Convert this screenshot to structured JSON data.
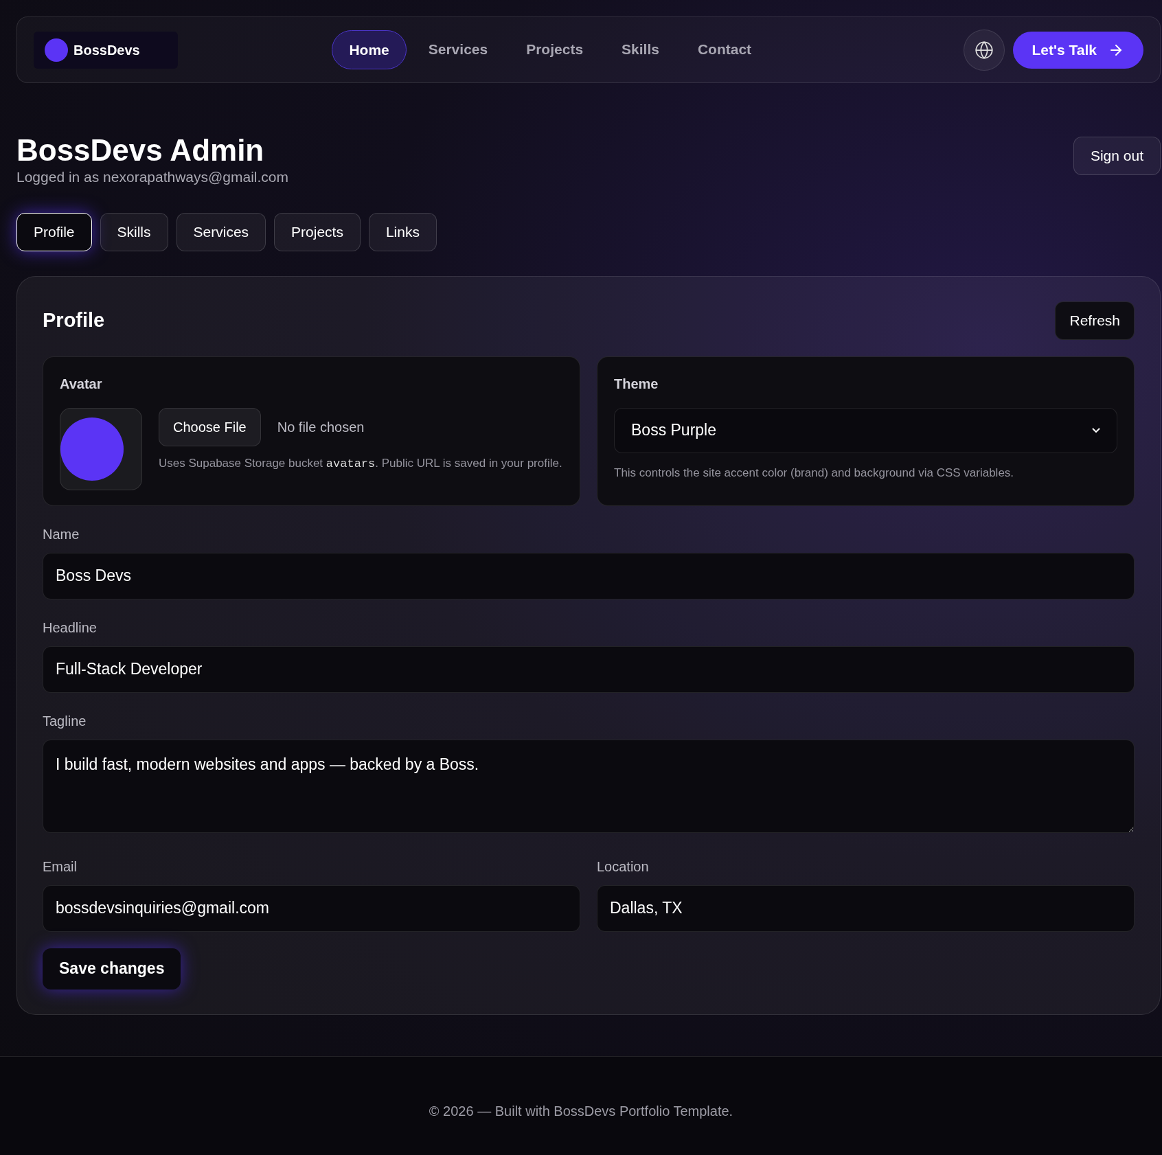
{
  "nav": {
    "brand": "BossDevs",
    "links": [
      {
        "label": "Home",
        "selected": true
      },
      {
        "label": "Services",
        "selected": false
      },
      {
        "label": "Projects",
        "selected": false
      },
      {
        "label": "Skills",
        "selected": false
      },
      {
        "label": "Contact",
        "selected": false
      }
    ],
    "cta": "Let's Talk"
  },
  "header": {
    "title": "BossDevs Admin",
    "subtitle": "Logged in as nexorapathways@gmail.com",
    "sign_out": "Sign out"
  },
  "tabs": [
    {
      "label": "Profile",
      "selected": true
    },
    {
      "label": "Skills",
      "selected": false
    },
    {
      "label": "Services",
      "selected": false
    },
    {
      "label": "Projects",
      "selected": false
    },
    {
      "label": "Links",
      "selected": false
    }
  ],
  "profile": {
    "title": "Profile",
    "refresh": "Refresh",
    "avatar": {
      "label": "Avatar",
      "color": "#5b34f5",
      "choose_file": "Choose File",
      "file_status": "No file chosen",
      "hint_before": "Uses Supabase Storage bucket ",
      "hint_code": "avatars",
      "hint_after": ". Public URL is saved in your profile."
    },
    "theme": {
      "label": "Theme",
      "value": "Boss Purple",
      "hint": "This controls the site accent color (brand) and background via CSS variables."
    },
    "fields": [
      {
        "label": "Name",
        "value": "Boss Devs",
        "kind": "input"
      },
      {
        "label": "Headline",
        "value": "Full-Stack Developer",
        "kind": "input"
      },
      {
        "label": "Tagline",
        "value": "I build fast, modern websites and apps — backed by a Boss.",
        "kind": "textarea"
      }
    ],
    "pair_fields": [
      {
        "label": "Email",
        "value": "bossdevsinquiries@gmail.com"
      },
      {
        "label": "Location",
        "value": "Dallas, TX"
      }
    ],
    "save": "Save changes"
  },
  "footer": "© 2026 — Built with BossDevs Portfolio Template."
}
